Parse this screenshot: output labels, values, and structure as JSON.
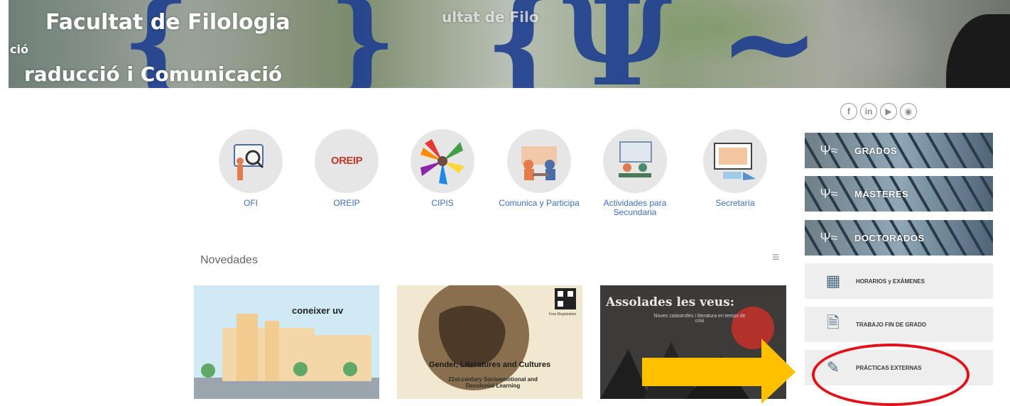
{
  "banner": {
    "title": "Facultat de Filologia",
    "sub1": "ció",
    "sub2": "raducció i Comunicació",
    "ghost": "ultat de Filo"
  },
  "social": [
    {
      "name": "facebook-icon",
      "glyph": "f"
    },
    {
      "name": "linkedin-icon",
      "glyph": "in"
    },
    {
      "name": "youtube-icon",
      "glyph": "▶"
    },
    {
      "name": "rss-icon",
      "glyph": "◉"
    }
  ],
  "quick_links": [
    {
      "label": "OFI"
    },
    {
      "label": "OREIP",
      "logo_text": "OREIP"
    },
    {
      "label": "CIPIS"
    },
    {
      "label": "Comunica y Participa"
    },
    {
      "label": "Actividades para Secundaria"
    },
    {
      "label": "Secretaría"
    }
  ],
  "novedades": {
    "title": "Novedades",
    "cards": [
      {
        "caption": "coneixer uv"
      },
      {
        "caption": "Gender, Literatures and Cultures",
        "subcaption": "21st-century Socioemotional and Decolonial Learning",
        "tag": "Free Registration"
      },
      {
        "caption": "Assolades les veus:",
        "subcaption": "Noves catàstrofes i literatura en temps de crisi"
      }
    ]
  },
  "sidebar": {
    "banners": [
      {
        "label": "GRADOS"
      },
      {
        "label": "MÁSTERES"
      },
      {
        "label": "DOCTORADOS"
      }
    ],
    "items": [
      {
        "label": "HORARIOS y EXÁMENES"
      },
      {
        "label": "TRABAJO FIN DE GRADO"
      },
      {
        "label": "PRÁCTICAS EXTERNAS"
      }
    ]
  },
  "colors": {
    "link_blue": "#3f6fb5",
    "arrow": "#ffc000",
    "highlight": "#e0121b",
    "sidebar_item_bg": "#eeeeee"
  }
}
